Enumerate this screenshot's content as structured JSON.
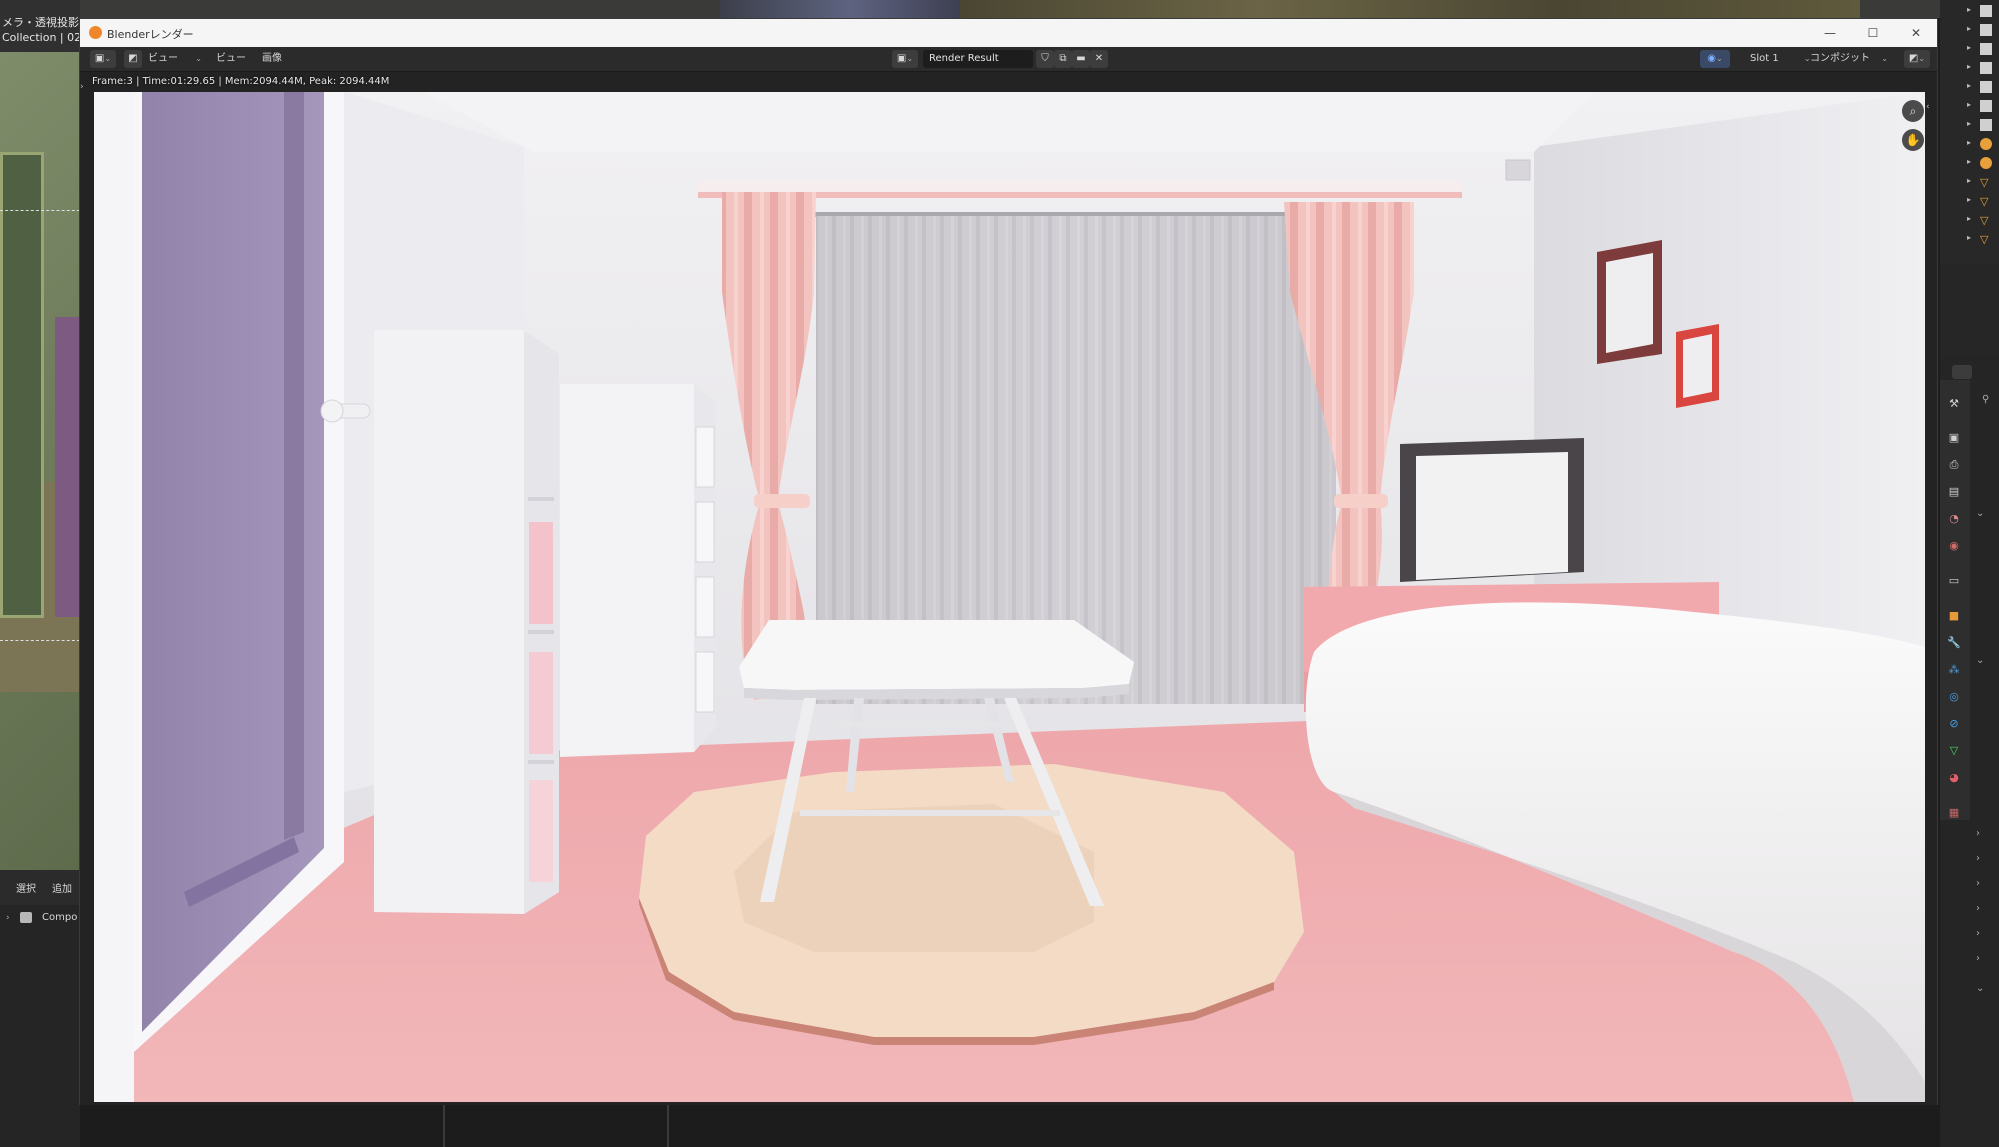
{
  "background": {
    "viewport_header_lines": [
      "メラ・透視投影",
      "Collection | 02_"
    ],
    "node_menu": [
      "選択",
      "追加"
    ],
    "outliner_item": "Compo"
  },
  "window": {
    "title": "Blenderレンダー",
    "minimize_glyph": "—",
    "maximize_glyph": "☐",
    "close_glyph": "✕"
  },
  "toolbar": {
    "menu_view": "ビュー",
    "menu_view2": "ビュー",
    "menu_image": "画像",
    "image_name": "Render Result",
    "slot": "Slot 1",
    "layer": "コンポジット"
  },
  "stats": "Frame:3 | Time:01:29.65 | Mem:2094.44M, Peak: 2094.44M",
  "icons": {
    "editor_type": "image-editor-icon",
    "zoom": "zoom-icon",
    "pan": "hand-icon"
  },
  "colors": {
    "wall": "#e4e2e6",
    "floor": "#efaeb1",
    "door": "#a292b8",
    "curtain": "#f2bfbb",
    "rug": "#f3dac3",
    "blender_orange": "#f0862b"
  }
}
